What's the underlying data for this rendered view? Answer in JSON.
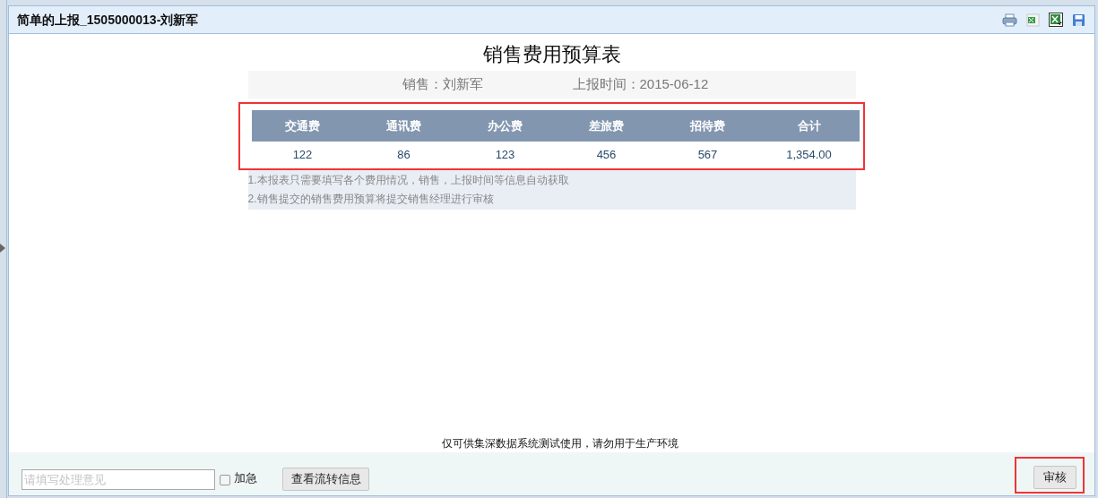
{
  "window": {
    "title": "简单的上报_1505000013-刘新军"
  },
  "report": {
    "title": "销售费用预算表",
    "info": [
      "销售：刘新军",
      "上报时间：2015-06-12"
    ],
    "table": {
      "columns": [
        "交通费",
        "通讯费",
        "办公费",
        "差旅费",
        "招待费",
        "合计"
      ],
      "rows": [
        [
          "122",
          "86",
          "123",
          "456",
          "567",
          "1,354.00"
        ]
      ]
    },
    "notes": [
      "1.本报表只需要填写各个费用情况，销售，上报时间等信息自动获取",
      "2.销售提交的销售费用预算将提交销售经理进行审核"
    ]
  },
  "footer_notice": "仅可供集深数据系统测试使用，请勿用于生产环境",
  "action_bar": {
    "opinion": {
      "placeholder": "请填写处理意见"
    },
    "urgent": {
      "label": "加急",
      "checked": false
    },
    "history_button": "查看流转信息",
    "approve_button": "审核"
  }
}
